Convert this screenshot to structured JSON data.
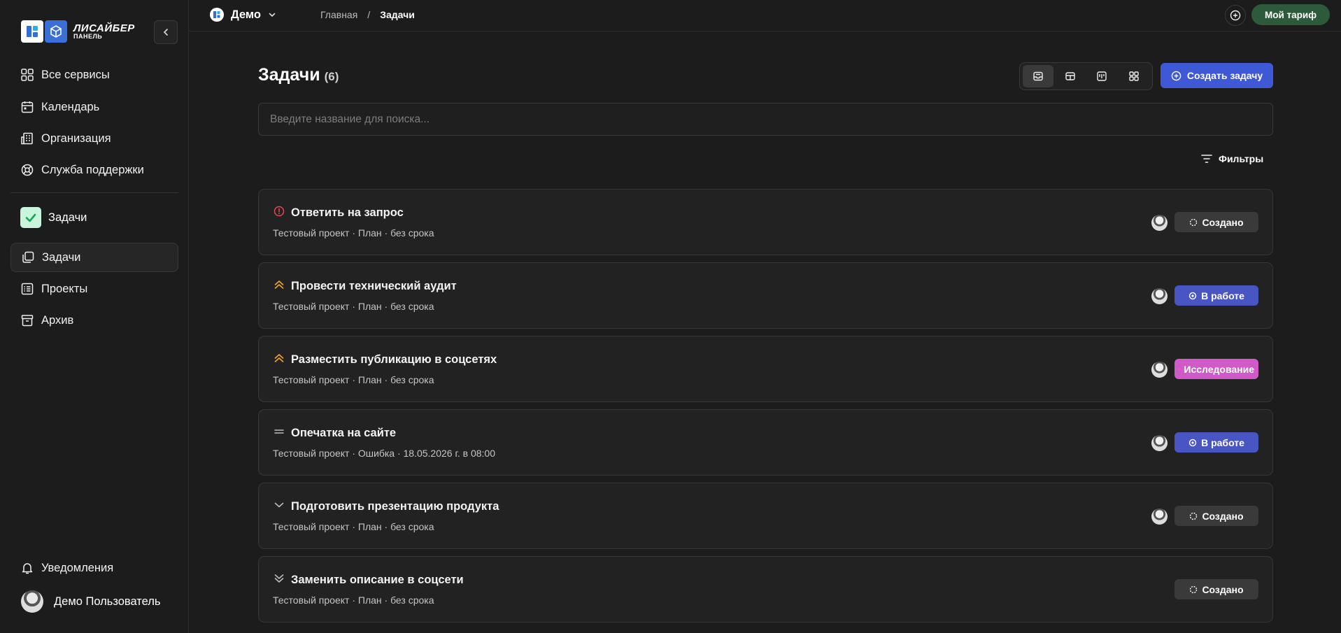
{
  "sidebar": {
    "logo": {
      "line1": "ЛИСАЙБЕР",
      "line2": "ПАНЕЛЬ"
    },
    "nav_top": [
      {
        "label": "Все сервисы",
        "icon": "grid-icon"
      },
      {
        "label": "Календарь",
        "icon": "calendar-icon"
      },
      {
        "label": "Организация",
        "icon": "building-icon"
      },
      {
        "label": "Служба поддержки",
        "icon": "lifebuoy-icon"
      }
    ],
    "section_title": "Задачи",
    "nav_tasks": [
      {
        "label": "Задачи",
        "icon": "tasks-icon",
        "active": true
      },
      {
        "label": "Проекты",
        "icon": "list-icon",
        "active": false
      },
      {
        "label": "Архив",
        "icon": "archive-icon",
        "active": false
      }
    ],
    "notifications_label": "Уведомления",
    "user_name": "Демо Пользователь"
  },
  "topbar": {
    "workspace": "Демо",
    "breadcrumb": {
      "home": "Главная",
      "sep": "/",
      "current": "Задачи"
    },
    "tariff_label": "Мой тариф"
  },
  "main": {
    "title": "Задачи",
    "count": "(6)",
    "create_label": "Создать задачу",
    "search_placeholder": "Введите название для поиска...",
    "filters_label": "Фильтры",
    "views": [
      "inbox-icon",
      "table-icon",
      "board-icon",
      "grid-icon"
    ]
  },
  "tasks": [
    {
      "title": "Ответить на запрос",
      "meta": "Тестовый проект · План · без срока",
      "priority": "urgent",
      "status": "Создано",
      "status_kind": "created",
      "avatar": true
    },
    {
      "title": "Провести технический аудит",
      "meta": "Тестовый проект · План · без срока",
      "priority": "high",
      "status": "В работе",
      "status_kind": "work",
      "avatar": true
    },
    {
      "title": "Разместить публикацию в соцсетях",
      "meta": "Тестовый проект · План · без срока",
      "priority": "high",
      "status": "Исследование",
      "status_kind": "research",
      "avatar": true
    },
    {
      "title": "Опечатка на сайте",
      "meta": "Тестовый проект · Ошибка · 18.05.2026 г. в 08:00",
      "priority": "medium",
      "status": "В работе",
      "status_kind": "work",
      "avatar": true
    },
    {
      "title": "Подготовить презентацию продукта",
      "meta": "Тестовый проект · План · без срока",
      "priority": "low",
      "status": "Создано",
      "status_kind": "created",
      "avatar": true
    },
    {
      "title": "Заменить описание в соцсети",
      "meta": "Тестовый проект · План · без срока",
      "priority": "lowest",
      "status": "Создано",
      "status_kind": "created",
      "avatar": false
    }
  ],
  "colors": {
    "background": "#1c1c1c",
    "card": "#222222",
    "accent_blue": "#3e58d6",
    "tariff_green": "#2c5a3a",
    "urgent_red": "#e5484d",
    "high_orange": "#f5a524",
    "research_pink": "#d05bc8",
    "work_indigo": "#4a55c4"
  }
}
